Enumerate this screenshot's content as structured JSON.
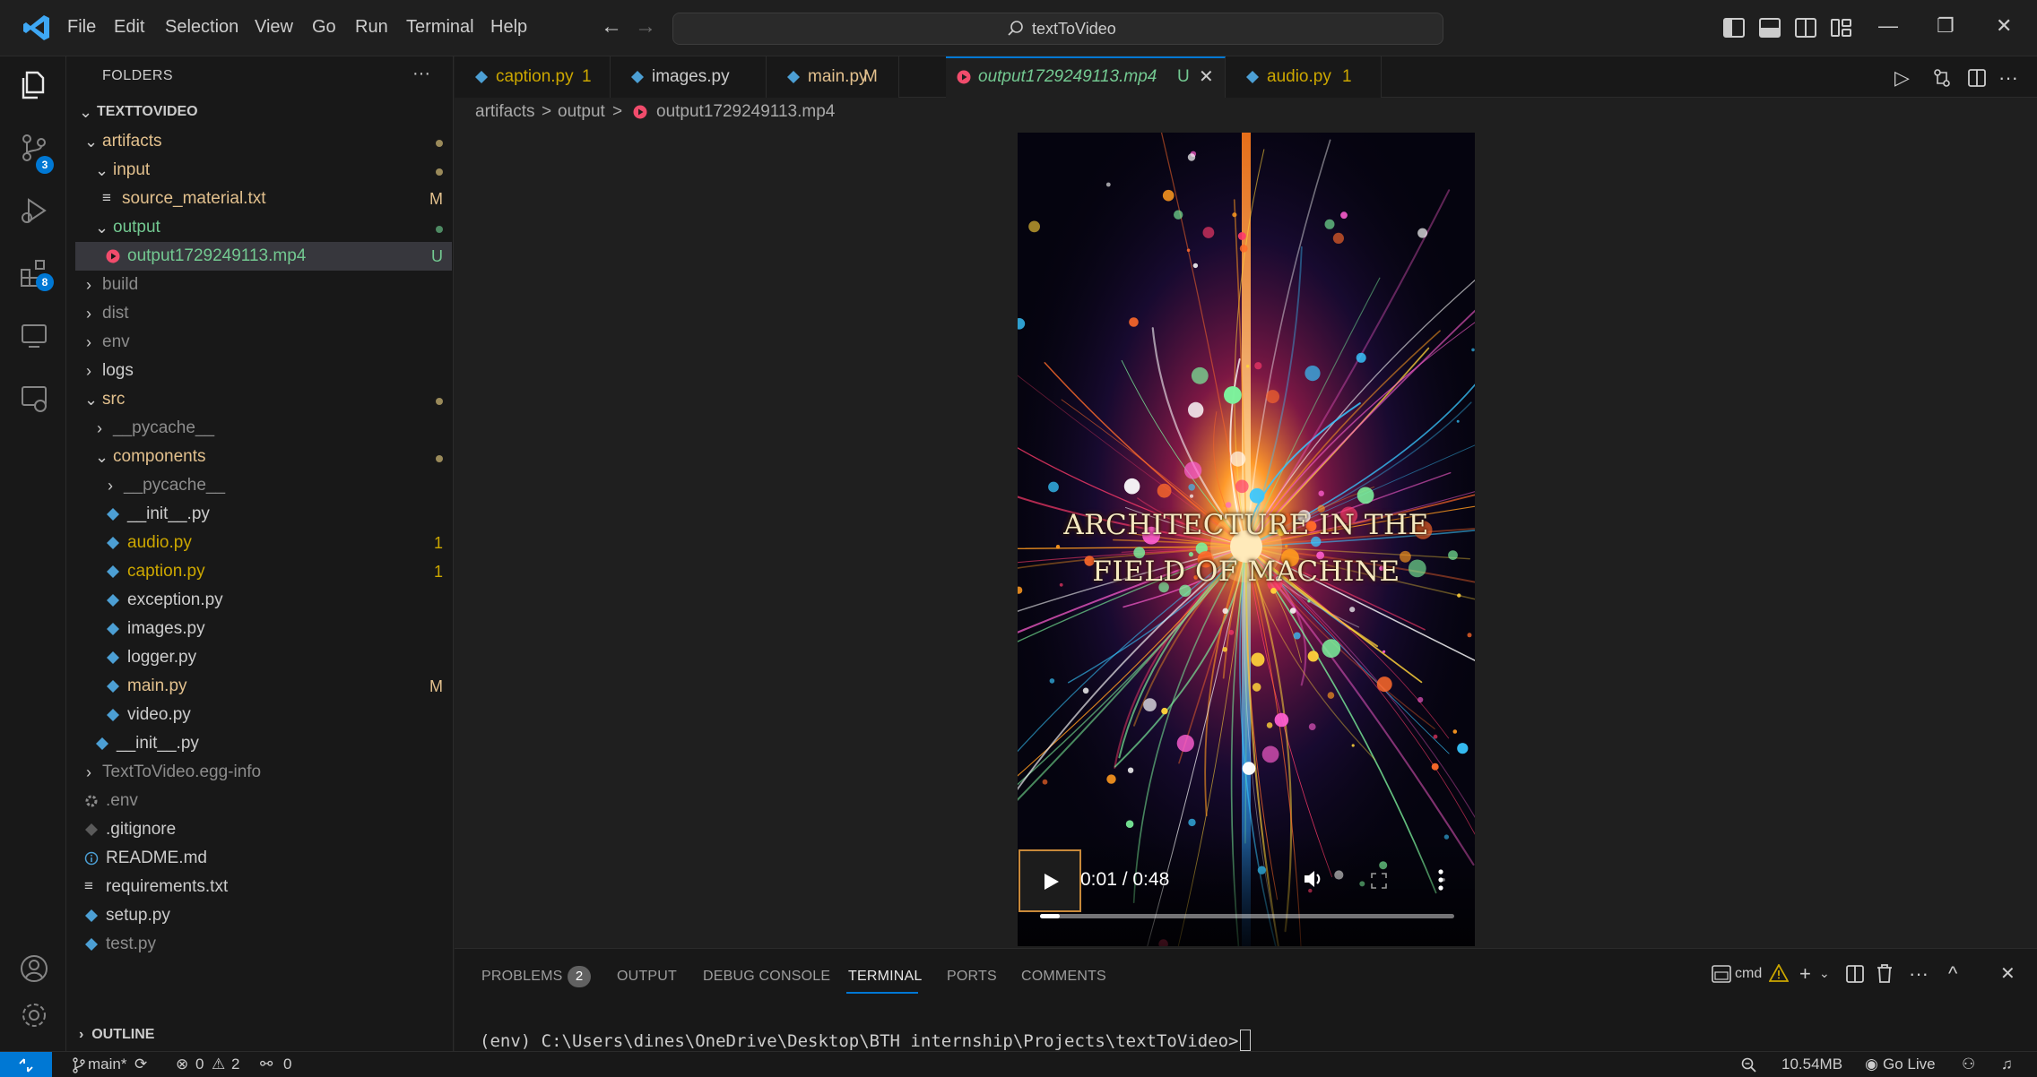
{
  "titlebar": {
    "menu": [
      "File",
      "Edit",
      "Selection",
      "View",
      "Go",
      "Run",
      "Terminal",
      "Help"
    ],
    "search_text": "textToVideo"
  },
  "activity": {
    "source_control_badge": "3",
    "extensions_badge": "8"
  },
  "sidebar": {
    "title": "FOLDERS",
    "more": "···",
    "root": "TEXTTOVIDEO",
    "outline": "OUTLINE",
    "items": [
      {
        "label": "artifacts",
        "deco": ""
      },
      {
        "label": "input",
        "deco": ""
      },
      {
        "label": "source_material.txt",
        "deco": "M"
      },
      {
        "label": "output",
        "deco": ""
      },
      {
        "label": "output1729249113.mp4",
        "deco": "U"
      },
      {
        "label": "build",
        "deco": ""
      },
      {
        "label": "dist",
        "deco": ""
      },
      {
        "label": "env",
        "deco": ""
      },
      {
        "label": "logs",
        "deco": ""
      },
      {
        "label": "src",
        "deco": ""
      },
      {
        "label": "__pycache__",
        "deco": ""
      },
      {
        "label": "components",
        "deco": ""
      },
      {
        "label": "__pycache__",
        "deco": ""
      },
      {
        "label": "__init__.py",
        "deco": ""
      },
      {
        "label": "audio.py",
        "deco": "1"
      },
      {
        "label": "caption.py",
        "deco": "1"
      },
      {
        "label": "exception.py",
        "deco": ""
      },
      {
        "label": "images.py",
        "deco": ""
      },
      {
        "label": "logger.py",
        "deco": ""
      },
      {
        "label": "main.py",
        "deco": "M"
      },
      {
        "label": "video.py",
        "deco": ""
      },
      {
        "label": "__init__.py",
        "deco": ""
      },
      {
        "label": "TextToVideo.egg-info",
        "deco": ""
      },
      {
        "label": ".env",
        "deco": ""
      },
      {
        "label": ".gitignore",
        "deco": ""
      },
      {
        "label": "README.md",
        "deco": ""
      },
      {
        "label": "requirements.txt",
        "deco": ""
      },
      {
        "label": "setup.py",
        "deco": ""
      },
      {
        "label": "test.py",
        "deco": ""
      }
    ]
  },
  "tabs": [
    {
      "label": "caption.py",
      "deco": "1"
    },
    {
      "label": "images.py",
      "deco": ""
    },
    {
      "label": "main.py",
      "deco": "M"
    },
    {
      "label": "output1729249113.mp4",
      "deco": "U"
    },
    {
      "label": "audio.py",
      "deco": "1"
    }
  ],
  "breadcrumb": [
    "artifacts",
    ">",
    "output",
    ">",
    "output1729249113.mp4"
  ],
  "video": {
    "caption_line1": "ARCHITECTURE IN THE",
    "caption_line2": "FIELD OF MACHINE",
    "time": "0:01 / 0:48",
    "progress": 0.047
  },
  "panel": {
    "tabs": [
      "PROBLEMS",
      "OUTPUT",
      "DEBUG CONSOLE",
      "TERMINAL",
      "PORTS",
      "COMMENTS"
    ],
    "problems_count": "2",
    "shell": "cmd",
    "terminal_line": "(env) C:\\Users\\dines\\OneDrive\\Desktop\\BTH internship\\Projects\\textToVideo>"
  },
  "statusbar": {
    "branch": "main*",
    "errors": "0",
    "warnings": "2",
    "ports": "0",
    "memory": "10.54MB",
    "go_live": "Go Live"
  },
  "colors": {
    "accent": "#0078d4",
    "modified": "#e2c08d",
    "untracked": "#73c991",
    "ignored": "#8c8c8c",
    "video_icon": "#f14c6c",
    "python_icon": "#4c9fd4"
  }
}
